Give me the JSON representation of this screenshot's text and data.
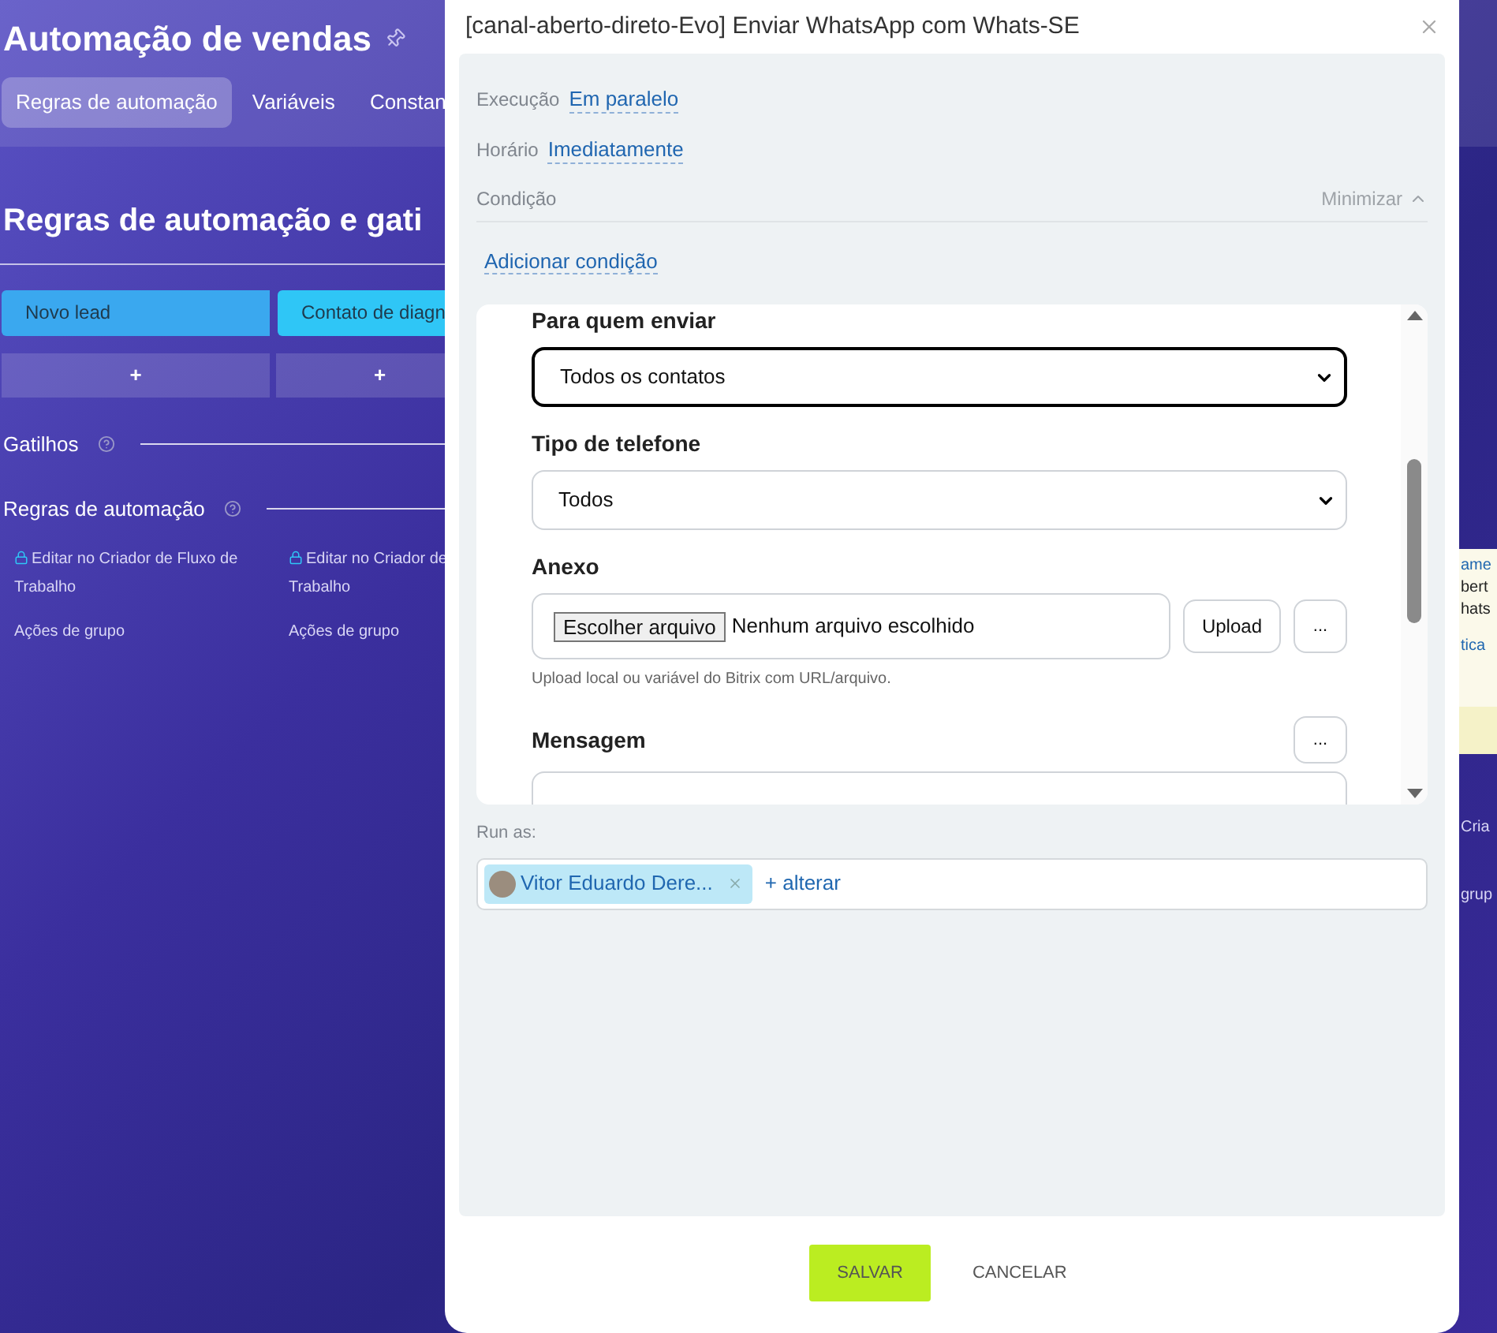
{
  "page": {
    "title": "Automação de vendas",
    "tabs": [
      {
        "label": "Regras de automação",
        "selected": true
      },
      {
        "label": "Variáveis",
        "selected": false
      },
      {
        "label": "Constan",
        "selected": false
      }
    ],
    "heading": "Regras de automação e gati",
    "stages": [
      {
        "label": "Novo lead",
        "color": "#3aa8ef"
      },
      {
        "label": "Contato de diagn",
        "color": "#2fc6f6"
      }
    ],
    "add_buttons": [
      "+",
      "+"
    ],
    "sections": [
      "Gatilhos",
      "Regras de automação"
    ],
    "columns": [
      {
        "line1": "Editar no Criador de Fluxo de",
        "line2": "Trabalho",
        "group_actions": "Ações de grupo"
      },
      {
        "line1": "Editar no Criador de",
        "line2": "Trabalho",
        "group_actions": "Ações de grupo"
      }
    ],
    "right_strip": [
      {
        "kind": "link",
        "text": "ame"
      },
      {
        "kind": "text",
        "text": "bert"
      },
      {
        "kind": "text",
        "text": "hats"
      },
      {
        "kind": "link",
        "text": "tica"
      },
      {
        "kind": "bg",
        "text": "Cria"
      },
      {
        "kind": "bg",
        "text": "grup"
      }
    ]
  },
  "dialog": {
    "title": "[canal-aberto-direto-Evo] Enviar WhatsApp com Whats-SE",
    "settings": [
      {
        "label": "Execução",
        "value": "Em paralelo"
      },
      {
        "label": "Horário",
        "value": "Imediatamente"
      }
    ],
    "condition": {
      "label": "Condição",
      "toggle": "Minimizar",
      "expanded": true,
      "add_link": "Adicionar condição"
    },
    "fields": [
      {
        "kind": "select",
        "label": "Para quem enviar",
        "value": "Todos os contatos",
        "focused": true
      },
      {
        "kind": "select",
        "label": "Tipo de telefone",
        "value": "Todos",
        "focused": false
      },
      {
        "kind": "file",
        "label": "Anexo",
        "button": "Escolher arquivo",
        "status": "Nenhum arquivo escolhido",
        "upload": "Upload",
        "more": "...",
        "hint": "Upload local ou variável do Bitrix com URL/arquivo."
      },
      {
        "kind": "textarea",
        "label": "Mensagem",
        "more": "..."
      }
    ],
    "run_as": {
      "label": "Run as:",
      "user": "Vitor Eduardo Dere...",
      "change": "+ alterar"
    },
    "buttons": [
      {
        "label": "SALVAR",
        "kind": "primary"
      },
      {
        "label": "CANCELAR",
        "kind": "secondary"
      }
    ]
  }
}
